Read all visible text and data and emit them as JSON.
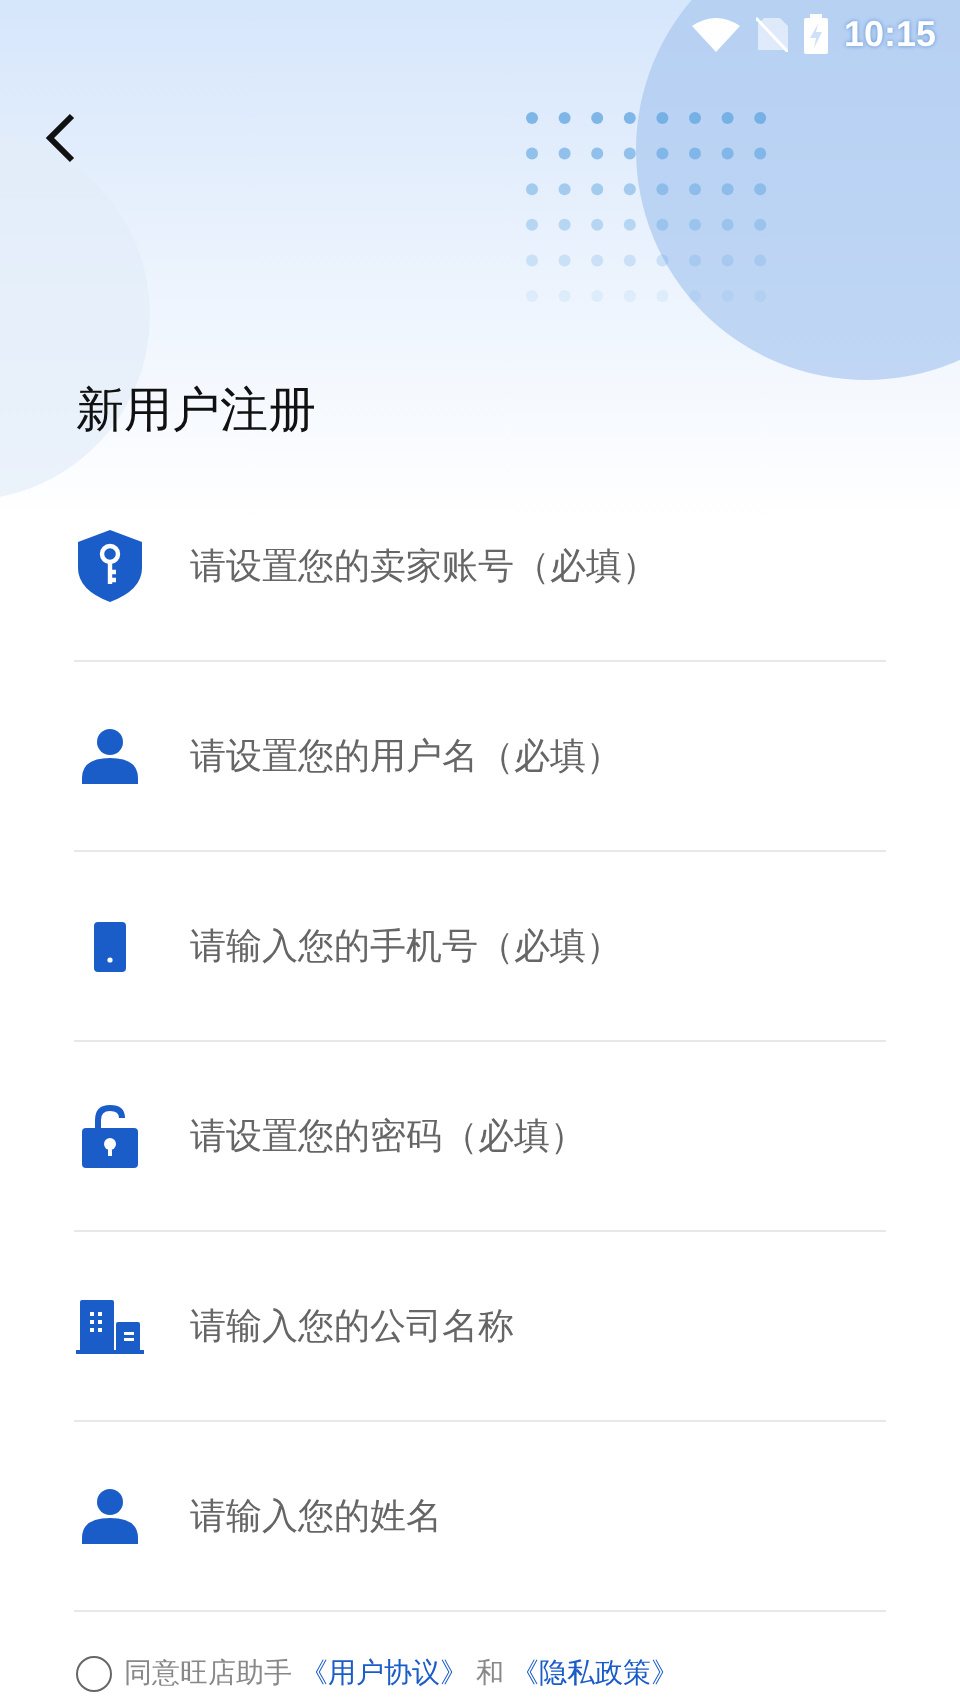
{
  "status_bar": {
    "time": "10:15"
  },
  "title": "新用户注册",
  "fields": [
    {
      "kind": "account",
      "placeholder": "请设置您的卖家账号（必填）"
    },
    {
      "kind": "user",
      "placeholder": "请设置您的用户名（必填）"
    },
    {
      "kind": "phone",
      "placeholder": "请输入您的手机号（必填）"
    },
    {
      "kind": "password",
      "placeholder": "请设置您的密码（必填）"
    },
    {
      "kind": "company",
      "placeholder": "请输入您的公司名称"
    },
    {
      "kind": "user",
      "placeholder": "请输入您的姓名"
    }
  ],
  "agreement": {
    "checked": false,
    "text": "同意旺店助手",
    "link_1": "《用户协议》",
    "conjunction": "和",
    "link_2": "《隐私政策》"
  }
}
